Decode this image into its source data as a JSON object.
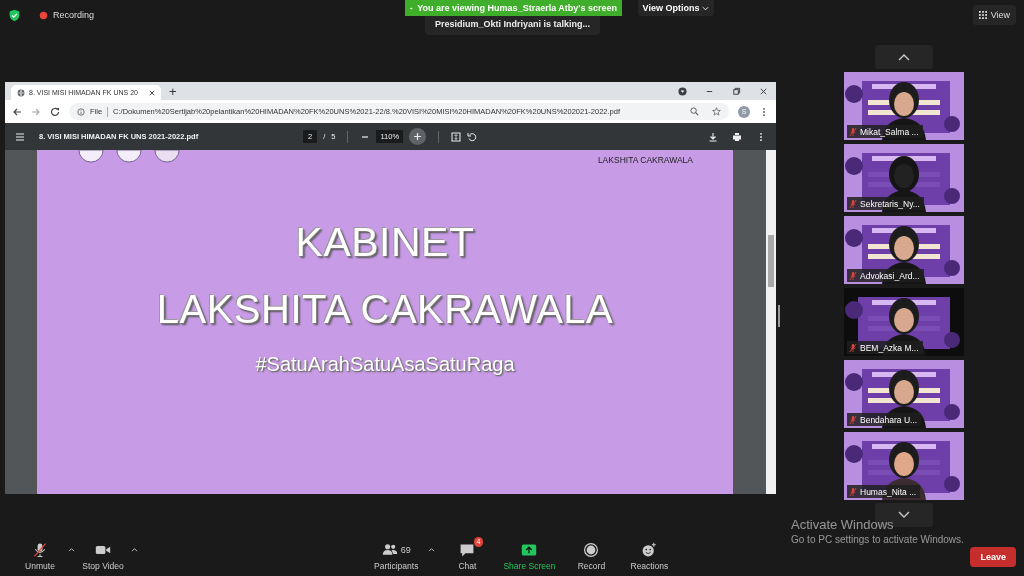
{
  "top_bar": {
    "recording": "Recording",
    "view": "View"
  },
  "share_banner": {
    "text": "You are viewing Humas_Straerla Atby's screen",
    "talking": "Presidium_Okti Indriyani is talking...",
    "view_options": "View Options"
  },
  "browser": {
    "tab": {
      "title": "8. VISI MISI HIMADAN FK UNS 20",
      "selected": true
    },
    "new_tab": "+",
    "url_scheme": "File",
    "url": "C:/Dokumen%20Sertijab%20pelantikan%20HIMADAN%20FK%20UNS%2021-22/8.%20VISI%20MISI%20HIMADAN%20FK%20UNS%202021-2022.pdf",
    "profile": "S"
  },
  "pdf": {
    "title": "8. VISI MISI HIMADAN FK UNS 2021-2022.pdf",
    "page": "2",
    "separator": "/",
    "pages": "5",
    "zoom": "110%",
    "page_content": {
      "header": "LAKSHITA CAKRAWALA",
      "title_1": "KABINET",
      "title_2": "LAKSHITA CAKRAWALA",
      "hashtag": "#SatuArahSatuAsaSatuRaga"
    }
  },
  "participants": [
    {
      "name": "Mikat_Salma ...",
      "muted": true
    },
    {
      "name": "Sekretaris_Ny...",
      "muted": true
    },
    {
      "name": "Advokasi_Ard...",
      "muted": true
    },
    {
      "name": "BEM_Azka M...",
      "muted": true
    },
    {
      "name": "Bendahara U...",
      "muted": true
    },
    {
      "name": "Humas_Nita ...",
      "muted": true
    }
  ],
  "toolbar": [
    {
      "kind": "mic",
      "label": "Unmute",
      "caret": true
    },
    {
      "kind": "video",
      "label": "Stop Video",
      "caret": true
    },
    {
      "kind": "participants",
      "label": "Participants",
      "count": "69",
      "caret": true
    },
    {
      "kind": "chat",
      "label": "Chat",
      "badge": "4",
      "caret": false
    },
    {
      "kind": "share",
      "label": "Share Screen",
      "caret": false
    },
    {
      "kind": "record",
      "label": "Record",
      "caret": false
    },
    {
      "kind": "reactions",
      "label": "Reactions",
      "caret": false
    }
  ],
  "leave": "Leave",
  "activation": {
    "title": "Activate Windows",
    "subtitle": "Go to PC settings to activate Windows."
  }
}
